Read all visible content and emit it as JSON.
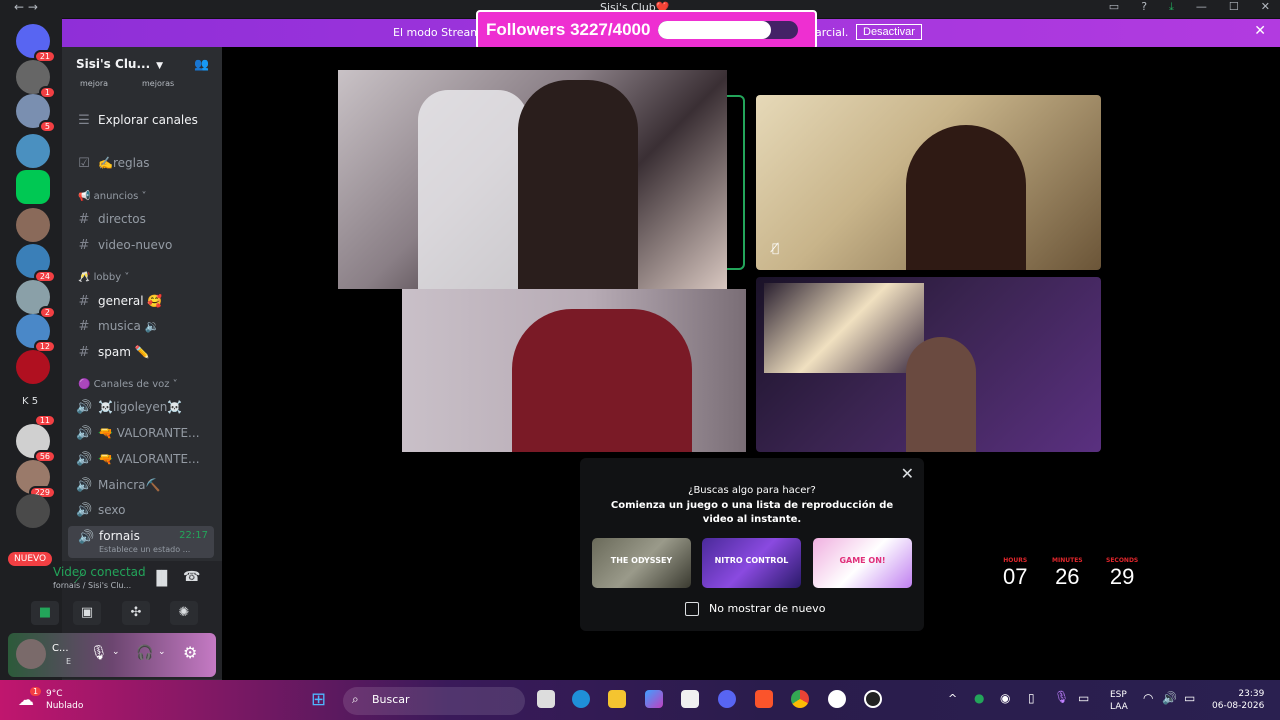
{
  "window": {
    "title": "Sisi's Club❤️",
    "nav": "←  →"
  },
  "banner": {
    "text_left": "El modo Stream",
    "text_right": "arcial.",
    "deactivate": "Desactivar",
    "close": "✕"
  },
  "followers": {
    "label": "Followers 3227/4000",
    "progress": 0.8067
  },
  "servers": {
    "badges": [
      "21",
      "1",
      "5",
      "24",
      "2",
      "12",
      "11",
      "56",
      "229"
    ],
    "letter_label": "K 5",
    "new_label": "NUEVO"
  },
  "sidebar": {
    "server_name": "Sisi's Clu...",
    "tiny_tags": [
      "mejora",
      "mejoras"
    ],
    "explore": "Explorar canales",
    "channels": [
      {
        "icon": "☑",
        "label": "✍️reglas",
        "bright": false
      },
      {
        "icon": "#",
        "label": "directos",
        "bright": false
      },
      {
        "icon": "#",
        "label": "video-nuevo",
        "bright": false
      },
      {
        "icon": "#",
        "label": "general 🥰",
        "bright": true
      },
      {
        "icon": "#",
        "label": "musica 🔉",
        "bright": false
      },
      {
        "icon": "#",
        "label": "spam ✏️",
        "bright": true
      }
    ],
    "categories": [
      "📢 anuncios ˅",
      "🥂 lobby ˅",
      "🟣 Canales de voz ˅"
    ],
    "voice_channels": [
      "☠️ligoleyen☠️",
      "🔫 VALORANTE...",
      "🔫 VALORANTE...",
      "Maincra⛏️",
      "sexo"
    ],
    "active_voice": {
      "name": "fornais",
      "time": "22:17",
      "status": "Establece un estado ..."
    },
    "connection": {
      "title": "Video conectad",
      "sub": "fornais / Sisi's Clu..."
    },
    "user": {
      "name": "C...",
      "status": "E"
    }
  },
  "popup": {
    "question": "¿Buscas algo para hacer?",
    "subtitle": "Comienza un juego o una lista de reproducción de video al instante.",
    "games": [
      "THE ODYSSEY",
      "NITRO CONTROL",
      "GAME ON!"
    ],
    "dont_show": "No mostrar de nuevo"
  },
  "timer": {
    "labels": [
      "HOURS",
      "MINUTES",
      "SECONDS"
    ],
    "values": [
      "07",
      "26",
      "29"
    ]
  },
  "taskbar": {
    "weather_temp": "9°C",
    "weather_desc": "Nublado",
    "weather_badge": "1",
    "search": "Buscar",
    "lang_top": "ESP",
    "lang_bottom": "LAA",
    "time": "23:39",
    "date": "06-08-2026"
  }
}
